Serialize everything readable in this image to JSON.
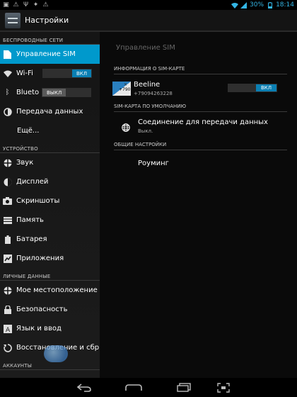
{
  "statusbar": {
    "battery": "30%",
    "time": "18:14"
  },
  "actionbar": {
    "title": "Настройки"
  },
  "left": {
    "section_wireless": "БЕСПРОВОДНЫЕ СЕТИ",
    "sim": "Управление SIM",
    "wifi": "Wi-Fi",
    "wifi_state": "ВКЛ",
    "bluetooth": "Blueto",
    "bluetooth_state": "ВЫКЛ",
    "data": "Передача данных",
    "more": "Ещё...",
    "section_device": "УСТРОЙСТВО",
    "sound": "Звук",
    "display": "Дисплей",
    "screenshots": "Скриншоты",
    "memory": "Память",
    "battery": "Батарея",
    "apps": "Приложения",
    "section_personal": "ЛИЧНЫЕ ДАННЫЕ",
    "location": "Мое местоположение",
    "security": "Безопасность",
    "language": "Язык и ввод",
    "restore": "Восстановление и сбр",
    "section_accounts": "АККАУНТЫ"
  },
  "right": {
    "title": "Управление SIM",
    "hdr_info": "ИНФОРМАЦИЯ О SIM-КАРТЕ",
    "sim_flag_text": "+790",
    "sim_name": "Beeline",
    "sim_phone": "+79094263228",
    "sim_state": "ВКЛ",
    "hdr_default": "SIM-КАРТА ПО УМОЛЧАНИЮ",
    "data_conn": "Соединение для передачи данных",
    "data_conn_sub": "Выкл.",
    "hdr_general": "ОБЩИЕ НАСТРОЙКИ",
    "roaming": "Роуминг"
  },
  "colors": {
    "accent": "#0099cc",
    "toggle_on": "#0a7fb3",
    "status": "#33b5e5"
  }
}
